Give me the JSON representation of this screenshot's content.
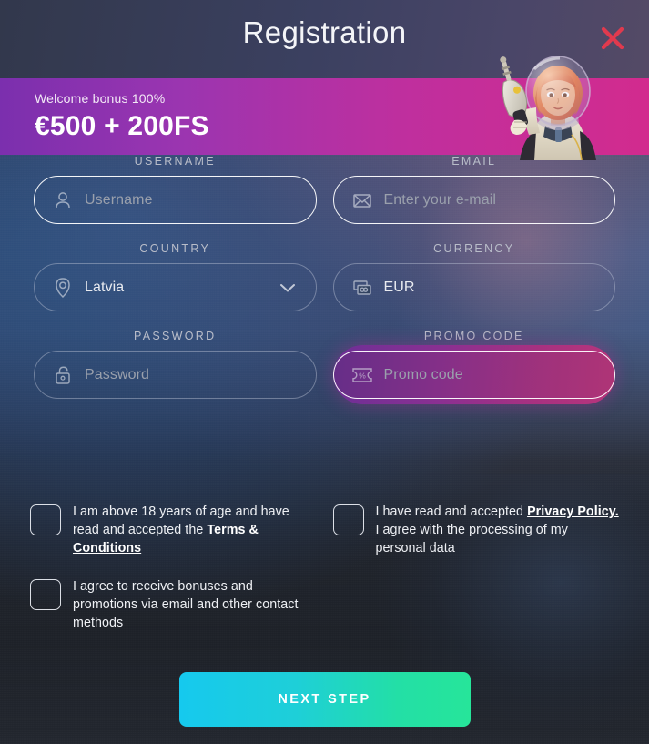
{
  "header": {
    "title": "Registration",
    "close_label": "Close",
    "close_color": "#e03a4e"
  },
  "banner": {
    "small_text": "Welcome bonus 100%",
    "big_text": "€500 + 200FS",
    "gradient_from": "#7b2fae",
    "gradient_to": "#d22b8e",
    "mascot_alt": "Retro sci-fi astronaut woman with ray gun"
  },
  "form": {
    "rows": [
      {
        "left": {
          "label": "USERNAME",
          "icon": "user-icon",
          "placeholder": "Username",
          "value": "",
          "focused": true,
          "type": "text"
        },
        "right": {
          "label": "EMAIL",
          "icon": "envelope-icon",
          "placeholder": "Enter your e-mail",
          "value": "",
          "focused": true,
          "type": "email"
        }
      },
      {
        "left": {
          "label": "COUNTRY",
          "icon": "location-pin-icon",
          "placeholder": "",
          "value": "Latvia",
          "focused": false,
          "type": "select",
          "chevron": true
        },
        "right": {
          "label": "CURRENCY",
          "icon": "banknotes-icon",
          "placeholder": "",
          "value": "EUR",
          "focused": false,
          "type": "select"
        }
      },
      {
        "left": {
          "label": "PASSWORD",
          "icon": "unlocked-padlock-icon",
          "placeholder": "Password",
          "value": "",
          "focused": false,
          "type": "password"
        },
        "right": {
          "label": "PROMO CODE",
          "icon": "ticket-percent-icon",
          "placeholder": "Promo code",
          "value": "",
          "focused": true,
          "highlighted": true,
          "type": "text"
        }
      }
    ]
  },
  "checkboxes": {
    "left": [
      {
        "checked": false,
        "parts": [
          {
            "text": "I am above 18 years of age and have read and accepted the ",
            "link": false
          },
          {
            "text": "Terms & Conditions",
            "link": true
          }
        ]
      },
      {
        "checked": false,
        "parts": [
          {
            "text": "I agree to receive bonuses and promotions via email and other contact methods",
            "link": false
          }
        ]
      }
    ],
    "right": [
      {
        "checked": false,
        "parts": [
          {
            "text": "I have read and accepted ",
            "link": false
          },
          {
            "text": "Privacy Policy.",
            "link": true
          },
          {
            "text": " I agree with the processing of my personal data",
            "link": false
          }
        ]
      }
    ]
  },
  "submit": {
    "label": "NEXT STEP",
    "gradient_from": "#16c9ee",
    "gradient_to": "#26e59a"
  }
}
